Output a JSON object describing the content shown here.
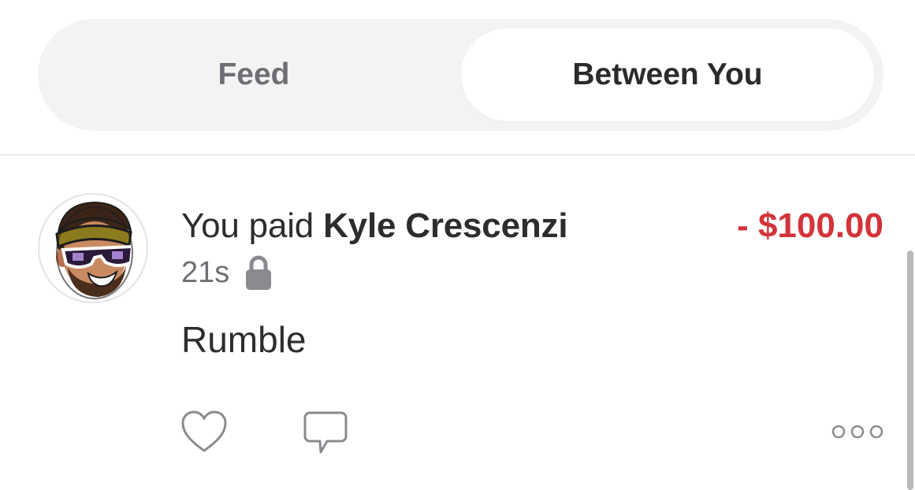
{
  "tabs": {
    "feed_label": "Feed",
    "between_label": "Between You",
    "selected": "Between You"
  },
  "story": {
    "avatar_icon": "cartoon-avatar-sunglasses-headband",
    "verb": "You paid ",
    "recipient": "Kyle Crescenzi",
    "amount": "- $100.00",
    "amount_color": "#d2343a",
    "timestamp": "21s",
    "privacy_icon": "lock-icon",
    "note": "Rumble",
    "actions": {
      "like_icon": "heart-icon",
      "comment_icon": "comment-icon",
      "more_icon": "more-options-icon"
    }
  }
}
